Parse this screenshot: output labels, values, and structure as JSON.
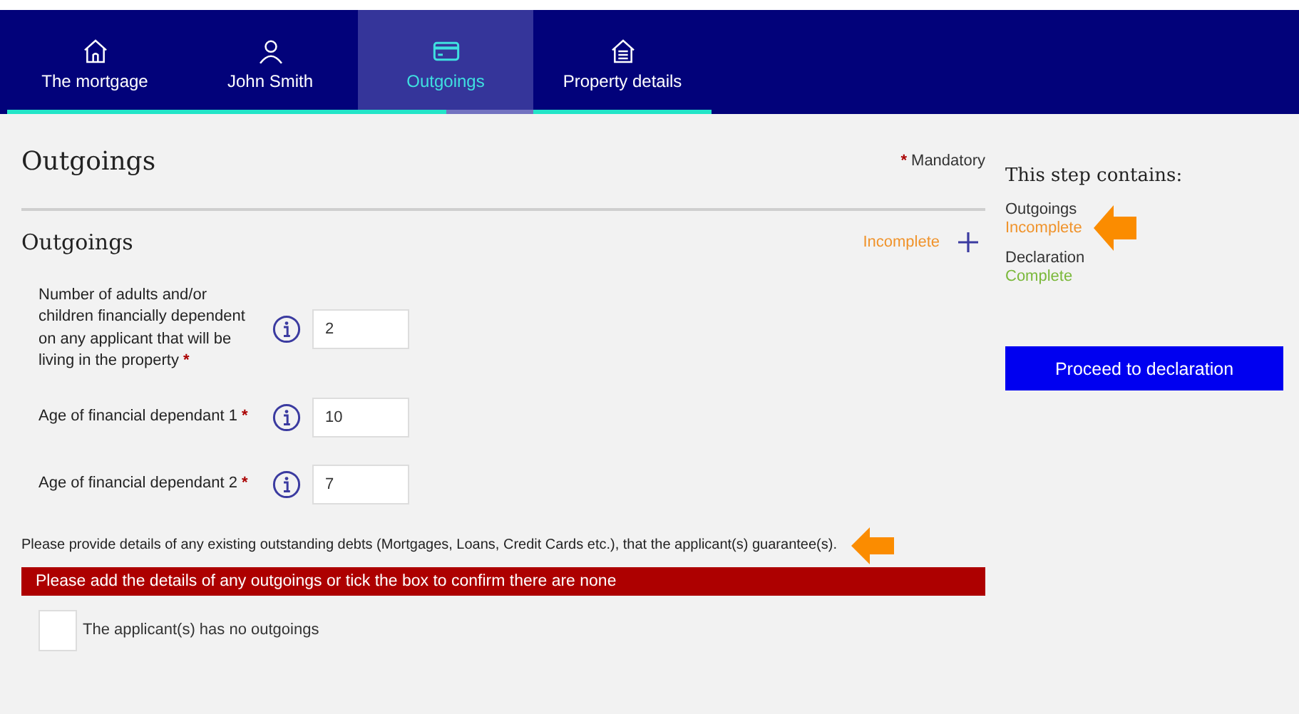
{
  "tabs": [
    {
      "label": "The mortgage",
      "selected": false,
      "level": 1
    },
    {
      "label": "John Smith",
      "selected": false,
      "level": 1
    },
    {
      "label": "Outgoings",
      "selected": true,
      "level": 0.5
    },
    {
      "label": "Property details",
      "selected": false,
      "level": 1
    }
  ],
  "page": {
    "title": "Outgoings",
    "mandatory_mark": "*",
    "mandatory_label": "Mandatory"
  },
  "section": {
    "title": "Outgoings",
    "status": "Incomplete",
    "complete": false,
    "expanded": false,
    "fields": [
      {
        "label": "Number of adults and/or children financially dependent on any applicant that will be living in the property",
        "required": true,
        "value": "2"
      },
      {
        "label": "Age of financial dependant 1",
        "required": true,
        "value": "10"
      },
      {
        "label": "Age of financial dependant 2",
        "required": true,
        "value": "7"
      }
    ],
    "note": "Please provide details of any existing outstanding debts (Mortgages, Loans, Credit Cards etc.), that the applicant(s) guarantee(s).",
    "error": "Please add the details of any outgoings or tick the box to confirm there are none",
    "checkbox": {
      "label": "The applicant(s) has no outgoings",
      "checked": false
    }
  },
  "sidebar": {
    "title": "This step contains:",
    "steps": [
      {
        "name": "Outgoings",
        "status": "Incomplete",
        "color": "#f0932b"
      },
      {
        "name": "Declaration",
        "status": "Complete",
        "color": "#7ab83a"
      }
    ],
    "button": "Proceed to declaration"
  }
}
